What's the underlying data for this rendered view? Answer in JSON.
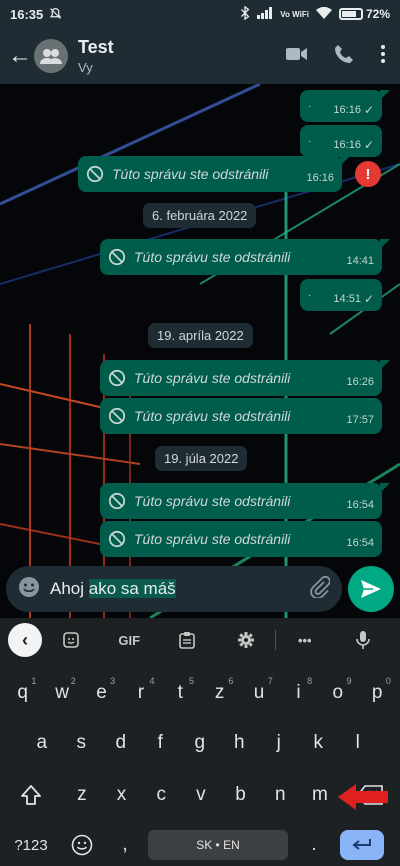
{
  "status_bar": {
    "time": "16:35",
    "carrier": "Vo WiFi",
    "battery": "72%"
  },
  "header": {
    "back": "←",
    "name": "Test",
    "subtitle": "Vy"
  },
  "messages": [
    {
      "time": "16:16",
      "dot": "·"
    },
    {
      "time": "16:16",
      "dot": "·"
    },
    {
      "text": "Túto správu ste odstránili",
      "time": "16:16"
    },
    {
      "date": "6. februára 2022"
    },
    {
      "text": "Túto správu ste odstránili",
      "time": "14:41"
    },
    {
      "time": "14:51",
      "dot": "·"
    },
    {
      "date": "19. apríla 2022"
    },
    {
      "text": "Túto správu ste odstránili",
      "time": "16:26"
    },
    {
      "text": "Túto správu ste odstránili",
      "time": "17:57"
    },
    {
      "date": "19. júla 2022"
    },
    {
      "text": "Túto správu ste odstránili",
      "time": "16:54"
    },
    {
      "text": "Túto správu ste odstránili",
      "time": "16:54"
    }
  ],
  "error_badge": "!",
  "composer": {
    "text_plain": "Ahoj ",
    "text_selected": "ako sa máš"
  },
  "keyboard": {
    "toolbar": {
      "gif": "GIF",
      "more": "•••"
    },
    "row1": [
      {
        "k": "q",
        "h": "1"
      },
      {
        "k": "w",
        "h": "2"
      },
      {
        "k": "e",
        "h": "3"
      },
      {
        "k": "r",
        "h": "4"
      },
      {
        "k": "t",
        "h": "5"
      },
      {
        "k": "z",
        "h": "6"
      },
      {
        "k": "u",
        "h": "7"
      },
      {
        "k": "i",
        "h": "8"
      },
      {
        "k": "o",
        "h": "9"
      },
      {
        "k": "p",
        "h": "0"
      }
    ],
    "row2": [
      "a",
      "s",
      "d",
      "f",
      "g",
      "h",
      "j",
      "k",
      "l"
    ],
    "row3": [
      "z",
      "x",
      "c",
      "v",
      "b",
      "n",
      "m"
    ],
    "symbols": "?123",
    "comma": ",",
    "space": "SK • EN",
    "period": "."
  },
  "colors": {
    "bubble": "#005c4b",
    "accent": "#00a884",
    "error": "#e53935",
    "enter": "#8ab4f8"
  }
}
